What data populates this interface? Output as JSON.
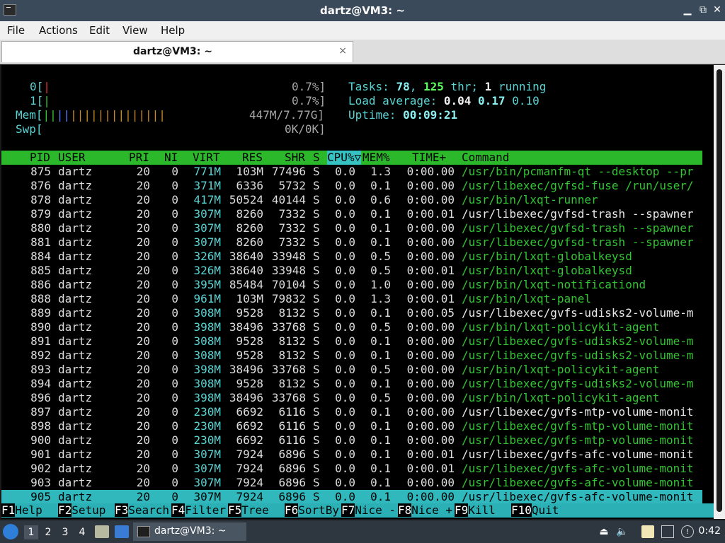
{
  "window": {
    "title": "dartz@VM3: ~"
  },
  "menu": [
    "File",
    "Actions",
    "Edit",
    "View",
    "Help"
  ],
  "tab": {
    "label": "dartz@VM3: ~",
    "close": "×"
  },
  "meters": {
    "cpu0_label": "0[",
    "cpu0_value": "0.7%]",
    "cpu1_label": "1[",
    "cpu1_value": "0.7%]",
    "mem_label": "Mem[",
    "mem_value": "447M/7.77G]",
    "swp_label": "Swp[",
    "swp_value": "0K/0K]",
    "tasks_label": "Tasks: ",
    "tasks": "78",
    "thr": "125",
    "thr_label": " thr; ",
    "running": "1",
    "running_label": " running",
    "load_label": "Load average: ",
    "load1": "0.04",
    "load5": "0.17",
    "load15": "0.10",
    "uptime_label": "Uptime: ",
    "uptime": "00:09:21"
  },
  "columns": [
    "PID",
    "USER",
    "PRI",
    "NI",
    "VIRT",
    "RES",
    "SHR",
    "S",
    "CPU%▽",
    "MEM%",
    "TIME+",
    "Command"
  ],
  "processes": [
    {
      "pid": "875",
      "user": "dartz",
      "pri": "20",
      "ni": "0",
      "virt": "771M",
      "res": "103M",
      "shr": "77496",
      "s": "S",
      "cpu": "0.0",
      "mem": "1.3",
      "time": "0:00.00",
      "cmd": "/usr/bin/pcmanfm-qt --desktop --pr",
      "thread": true
    },
    {
      "pid": "876",
      "user": "dartz",
      "pri": "20",
      "ni": "0",
      "virt": "371M",
      "res": "6336",
      "shr": "5732",
      "s": "S",
      "cpu": "0.0",
      "mem": "0.1",
      "time": "0:00.00",
      "cmd": "/usr/libexec/gvfsd-fuse /run/user/",
      "thread": true
    },
    {
      "pid": "878",
      "user": "dartz",
      "pri": "20",
      "ni": "0",
      "virt": "417M",
      "res": "50524",
      "shr": "40144",
      "s": "S",
      "cpu": "0.0",
      "mem": "0.6",
      "time": "0:00.00",
      "cmd": "/usr/bin/lxqt-runner",
      "thread": true
    },
    {
      "pid": "879",
      "user": "dartz",
      "pri": "20",
      "ni": "0",
      "virt": "307M",
      "res": "8260",
      "shr": "7332",
      "s": "S",
      "cpu": "0.0",
      "mem": "0.1",
      "time": "0:00.01",
      "cmd": "/usr/libexec/gvfsd-trash --spawner",
      "thread": false
    },
    {
      "pid": "880",
      "user": "dartz",
      "pri": "20",
      "ni": "0",
      "virt": "307M",
      "res": "8260",
      "shr": "7332",
      "s": "S",
      "cpu": "0.0",
      "mem": "0.1",
      "time": "0:00.00",
      "cmd": "/usr/libexec/gvfsd-trash --spawner",
      "thread": true
    },
    {
      "pid": "881",
      "user": "dartz",
      "pri": "20",
      "ni": "0",
      "virt": "307M",
      "res": "8260",
      "shr": "7332",
      "s": "S",
      "cpu": "0.0",
      "mem": "0.1",
      "time": "0:00.00",
      "cmd": "/usr/libexec/gvfsd-trash --spawner",
      "thread": true
    },
    {
      "pid": "884",
      "user": "dartz",
      "pri": "20",
      "ni": "0",
      "virt": "326M",
      "res": "38640",
      "shr": "33948",
      "s": "S",
      "cpu": "0.0",
      "mem": "0.5",
      "time": "0:00.00",
      "cmd": "/usr/bin/lxqt-globalkeysd",
      "thread": true
    },
    {
      "pid": "885",
      "user": "dartz",
      "pri": "20",
      "ni": "0",
      "virt": "326M",
      "res": "38640",
      "shr": "33948",
      "s": "S",
      "cpu": "0.0",
      "mem": "0.5",
      "time": "0:00.01",
      "cmd": "/usr/bin/lxqt-globalkeysd",
      "thread": true
    },
    {
      "pid": "886",
      "user": "dartz",
      "pri": "20",
      "ni": "0",
      "virt": "395M",
      "res": "85484",
      "shr": "70104",
      "s": "S",
      "cpu": "0.0",
      "mem": "1.0",
      "time": "0:00.00",
      "cmd": "/usr/bin/lxqt-notificationd",
      "thread": true
    },
    {
      "pid": "888",
      "user": "dartz",
      "pri": "20",
      "ni": "0",
      "virt": "961M",
      "res": "103M",
      "shr": "79832",
      "s": "S",
      "cpu": "0.0",
      "mem": "1.3",
      "time": "0:00.01",
      "cmd": "/usr/bin/lxqt-panel",
      "thread": true
    },
    {
      "pid": "889",
      "user": "dartz",
      "pri": "20",
      "ni": "0",
      "virt": "308M",
      "res": "9528",
      "shr": "8132",
      "s": "S",
      "cpu": "0.0",
      "mem": "0.1",
      "time": "0:00.05",
      "cmd": "/usr/libexec/gvfs-udisks2-volume-m",
      "thread": false
    },
    {
      "pid": "890",
      "user": "dartz",
      "pri": "20",
      "ni": "0",
      "virt": "398M",
      "res": "38496",
      "shr": "33768",
      "s": "S",
      "cpu": "0.0",
      "mem": "0.5",
      "time": "0:00.00",
      "cmd": "/usr/bin/lxqt-policykit-agent",
      "thread": true
    },
    {
      "pid": "891",
      "user": "dartz",
      "pri": "20",
      "ni": "0",
      "virt": "308M",
      "res": "9528",
      "shr": "8132",
      "s": "S",
      "cpu": "0.0",
      "mem": "0.1",
      "time": "0:00.00",
      "cmd": "/usr/libexec/gvfs-udisks2-volume-m",
      "thread": true
    },
    {
      "pid": "892",
      "user": "dartz",
      "pri": "20",
      "ni": "0",
      "virt": "308M",
      "res": "9528",
      "shr": "8132",
      "s": "S",
      "cpu": "0.0",
      "mem": "0.1",
      "time": "0:00.00",
      "cmd": "/usr/libexec/gvfs-udisks2-volume-m",
      "thread": true
    },
    {
      "pid": "893",
      "user": "dartz",
      "pri": "20",
      "ni": "0",
      "virt": "398M",
      "res": "38496",
      "shr": "33768",
      "s": "S",
      "cpu": "0.0",
      "mem": "0.5",
      "time": "0:00.00",
      "cmd": "/usr/bin/lxqt-policykit-agent",
      "thread": true
    },
    {
      "pid": "894",
      "user": "dartz",
      "pri": "20",
      "ni": "0",
      "virt": "308M",
      "res": "9528",
      "shr": "8132",
      "s": "S",
      "cpu": "0.0",
      "mem": "0.1",
      "time": "0:00.00",
      "cmd": "/usr/libexec/gvfs-udisks2-volume-m",
      "thread": true
    },
    {
      "pid": "896",
      "user": "dartz",
      "pri": "20",
      "ni": "0",
      "virt": "398M",
      "res": "38496",
      "shr": "33768",
      "s": "S",
      "cpu": "0.0",
      "mem": "0.5",
      "time": "0:00.00",
      "cmd": "/usr/bin/lxqt-policykit-agent",
      "thread": true
    },
    {
      "pid": "897",
      "user": "dartz",
      "pri": "20",
      "ni": "0",
      "virt": "230M",
      "res": "6692",
      "shr": "6116",
      "s": "S",
      "cpu": "0.0",
      "mem": "0.1",
      "time": "0:00.00",
      "cmd": "/usr/libexec/gvfs-mtp-volume-monit",
      "thread": false
    },
    {
      "pid": "898",
      "user": "dartz",
      "pri": "20",
      "ni": "0",
      "virt": "230M",
      "res": "6692",
      "shr": "6116",
      "s": "S",
      "cpu": "0.0",
      "mem": "0.1",
      "time": "0:00.00",
      "cmd": "/usr/libexec/gvfs-mtp-volume-monit",
      "thread": true
    },
    {
      "pid": "900",
      "user": "dartz",
      "pri": "20",
      "ni": "0",
      "virt": "230M",
      "res": "6692",
      "shr": "6116",
      "s": "S",
      "cpu": "0.0",
      "mem": "0.1",
      "time": "0:00.00",
      "cmd": "/usr/libexec/gvfs-mtp-volume-monit",
      "thread": true
    },
    {
      "pid": "901",
      "user": "dartz",
      "pri": "20",
      "ni": "0",
      "virt": "307M",
      "res": "7924",
      "shr": "6896",
      "s": "S",
      "cpu": "0.0",
      "mem": "0.1",
      "time": "0:00.01",
      "cmd": "/usr/libexec/gvfs-afc-volume-monit",
      "thread": false
    },
    {
      "pid": "902",
      "user": "dartz",
      "pri": "20",
      "ni": "0",
      "virt": "307M",
      "res": "7924",
      "shr": "6896",
      "s": "S",
      "cpu": "0.0",
      "mem": "0.1",
      "time": "0:00.01",
      "cmd": "/usr/libexec/gvfs-afc-volume-monit",
      "thread": true
    },
    {
      "pid": "903",
      "user": "dartz",
      "pri": "20",
      "ni": "0",
      "virt": "307M",
      "res": "7924",
      "shr": "6896",
      "s": "S",
      "cpu": "0.0",
      "mem": "0.1",
      "time": "0:00.00",
      "cmd": "/usr/libexec/gvfs-afc-volume-monit",
      "thread": true
    },
    {
      "pid": "905",
      "user": "dartz",
      "pri": "20",
      "ni": "0",
      "virt": "307M",
      "res": "7924",
      "shr": "6896",
      "s": "S",
      "cpu": "0.0",
      "mem": "0.1",
      "time": "0:00.00",
      "cmd": "/usr/libexec/gvfs-afc-volume-monit",
      "thread": true,
      "selected": true
    }
  ],
  "fkeys": [
    {
      "key": "F1",
      "label": "Help"
    },
    {
      "key": "F2",
      "label": "Setup"
    },
    {
      "key": "F3",
      "label": "Search"
    },
    {
      "key": "F4",
      "label": "Filter"
    },
    {
      "key": "F5",
      "label": "Tree  "
    },
    {
      "key": "F6",
      "label": "SortBy"
    },
    {
      "key": "F7",
      "label": "Nice -"
    },
    {
      "key": "F8",
      "label": "Nice +"
    },
    {
      "key": "F9",
      "label": "Kill  "
    },
    {
      "key": "F10",
      "label": "Quit"
    }
  ],
  "taskbar": {
    "workspaces": [
      "1",
      "2",
      "3",
      "4"
    ],
    "task_label": "dartz@VM3: ~",
    "clock": "0:42"
  },
  "colors": {
    "header_green": "#2bb82b",
    "select_cyan": "#30b8bc",
    "titlebar": "#3b4a5a",
    "taskbar": "#2e3640"
  }
}
